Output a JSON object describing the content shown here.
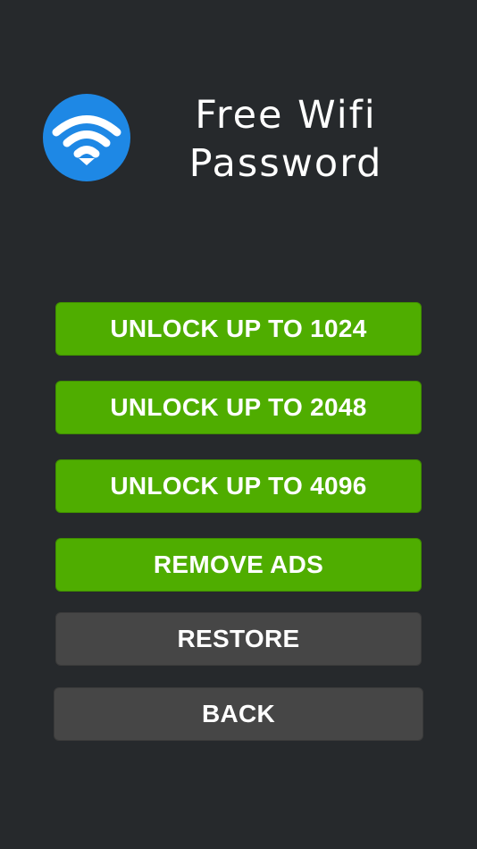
{
  "app": {
    "title_line1": "Free Wifi",
    "title_line2": "Password",
    "logo_icon": "wifi-icon"
  },
  "buttons": {
    "unlock_1024": "UNLOCK UP TO 1024",
    "unlock_2048": "UNLOCK UP TO 2048",
    "unlock_4096": "UNLOCK UP TO 4096",
    "remove_ads": "REMOVE ADS",
    "restore": "RESTORE",
    "back": "BACK"
  },
  "colors": {
    "background": "#26292c",
    "logo_blue": "#1e88e5",
    "primary_green": "#4fad00",
    "secondary_gray": "#464646",
    "text": "#ffffff"
  }
}
